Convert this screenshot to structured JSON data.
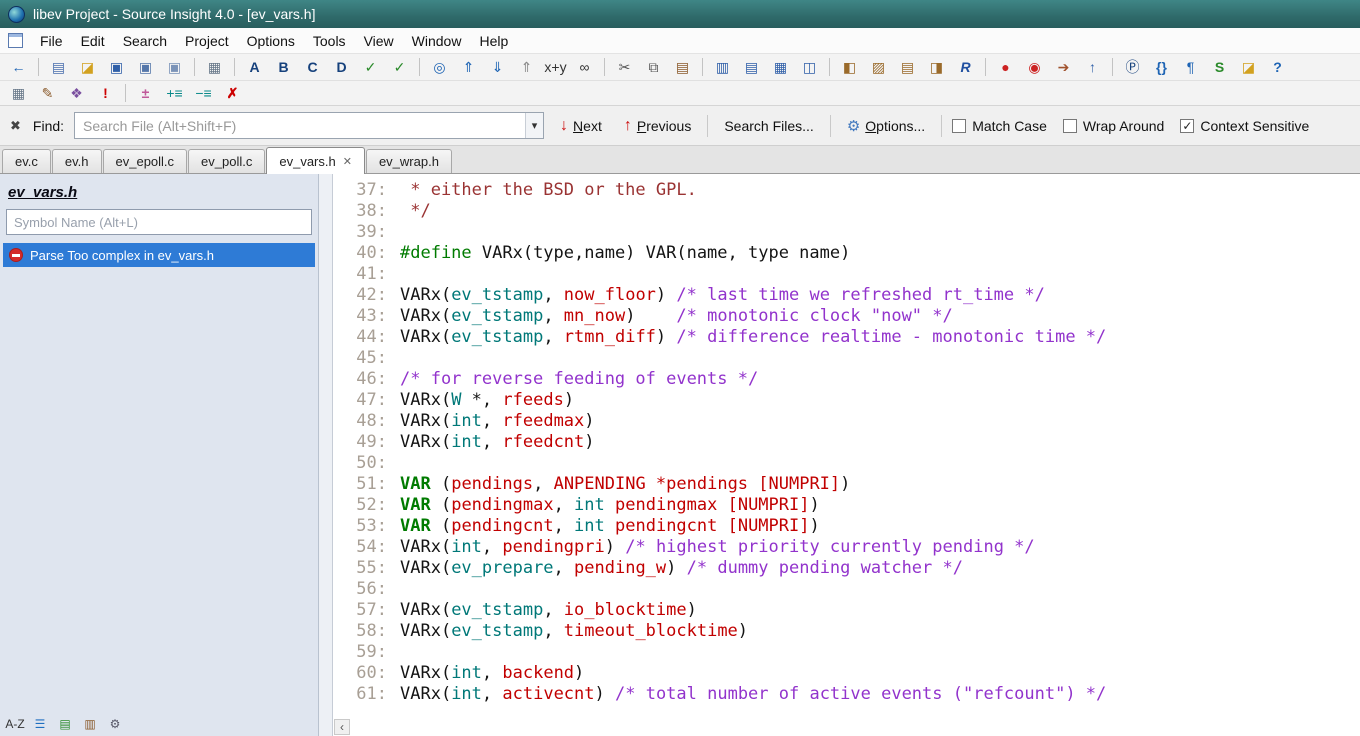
{
  "window": {
    "title": "libev Project - Source Insight 4.0 - [ev_vars.h]"
  },
  "menu": {
    "items": [
      "File",
      "Edit",
      "Search",
      "Project",
      "Options",
      "Tools",
      "View",
      "Window",
      "Help"
    ]
  },
  "colors": {
    "titlebar": "#2f6a6a",
    "selection_blue": "#2e7bd6",
    "syntax_keyword": "#007b00",
    "syntax_type": "#007878",
    "syntax_identifier": "#c10000",
    "syntax_comment_inline": "#9233cc",
    "syntax_comment_block": "#9a3333",
    "line_number": "#a89f95",
    "error_icon_red": "#d42a2a"
  },
  "toolbars": {
    "row1": [
      [
        {
          "n": "back-button",
          "g": "←",
          "c": "#1e64b4",
          "b": true
        }
      ],
      [
        {
          "n": "new-file-button",
          "g": "▤",
          "c": "#4a6fae"
        },
        {
          "n": "open-file-button",
          "g": "◪",
          "c": "#d2a11f"
        },
        {
          "n": "save-button",
          "g": "▣",
          "c": "#2f5fa8"
        },
        {
          "n": "save-as-button",
          "g": "▣",
          "c": "#5577aa"
        },
        {
          "n": "save-all-button",
          "g": "▣",
          "c": "#7a93b8"
        }
      ],
      [
        {
          "n": "print-button",
          "g": "▦",
          "c": "#667788"
        }
      ],
      [
        {
          "n": "custom-command-a-button",
          "g": "A",
          "c": "#16417c",
          "b": true
        },
        {
          "n": "custom-command-b-button",
          "g": "B",
          "c": "#16417c",
          "b": true
        },
        {
          "n": "custom-command-c-button",
          "g": "C",
          "c": "#16417c",
          "b": true
        },
        {
          "n": "custom-command-d-button",
          "g": "D",
          "c": "#16417c",
          "b": true
        },
        {
          "n": "checklist-1-button",
          "g": "✓",
          "c": "#2a8a2a"
        },
        {
          "n": "checklist-2-button",
          "g": "✓",
          "c": "#2a8a2a"
        }
      ],
      [
        {
          "n": "lookup-references-button",
          "g": "◎",
          "c": "#1e64b4"
        },
        {
          "n": "jump-to-caller-button",
          "g": "⇑",
          "c": "#1e64b4"
        },
        {
          "n": "jump-to-definition-button",
          "g": "⇓",
          "c": "#1e64b4"
        },
        {
          "n": "go-back-button",
          "g": "⇑",
          "c": "#888888"
        },
        {
          "n": "replace-button",
          "g": "x+y",
          "c": "#333333"
        },
        {
          "n": "browse-symbols-button",
          "g": "∞",
          "c": "#333333"
        }
      ],
      [
        {
          "n": "cut-button",
          "g": "✂",
          "c": "#555555"
        },
        {
          "n": "copy-button",
          "g": "⧉",
          "c": "#555555"
        },
        {
          "n": "paste-button",
          "g": "▤",
          "c": "#8a5a2b"
        }
      ],
      [
        {
          "n": "window-split-1-button",
          "g": "▥",
          "c": "#2f5fa8"
        },
        {
          "n": "window-split-2-button",
          "g": "▤",
          "c": "#2f5fa8"
        },
        {
          "n": "window-split-3-button",
          "g": "▦",
          "c": "#2f5fa8"
        },
        {
          "n": "window-split-4-button",
          "g": "◫",
          "c": "#2f5fa8"
        }
      ],
      [
        {
          "n": "project-window-button",
          "g": "◧",
          "c": "#9a6a2a"
        },
        {
          "n": "project-files-button",
          "g": "▨",
          "c": "#9a6a2a"
        },
        {
          "n": "symbol-window-button",
          "g": "▤",
          "c": "#9a6a2a"
        },
        {
          "n": "context-window-button",
          "g": "◨",
          "c": "#9a6a2a"
        },
        {
          "n": "relation-window-button",
          "g": "R",
          "c": "#1f4fa0",
          "b": true,
          "i": true
        }
      ],
      [
        {
          "n": "bookmark-toggle-button",
          "g": "●",
          "c": "#cc2222"
        },
        {
          "n": "bookmark-list-button",
          "g": "◉",
          "c": "#cc2222"
        },
        {
          "n": "jump-bookmark-button",
          "g": "➔",
          "c": "#a0522d"
        },
        {
          "n": "stack-up-button",
          "g": "↑",
          "c": "#2f5fa8",
          "b": true
        }
      ],
      [
        {
          "n": "parse-source-button",
          "g": "Ⓟ",
          "c": "#16417c"
        },
        {
          "n": "braces-button",
          "g": "{}",
          "c": "#1e64b4",
          "b": true
        },
        {
          "n": "reformat-button",
          "g": "¶",
          "c": "#1e64b4"
        },
        {
          "n": "script-button",
          "g": "S",
          "c": "#2a8a2a",
          "b": true
        },
        {
          "n": "reload-file-button",
          "g": "◪",
          "c": "#d2a11f"
        },
        {
          "n": "help-doc-button",
          "g": "?",
          "c": "#1e64b4",
          "b": true
        }
      ]
    ],
    "row2": [
      [
        {
          "n": "grid-view-button",
          "g": "▦",
          "c": "#667788"
        },
        {
          "n": "draft-edit-button",
          "g": "✎",
          "c": "#8a5a2b"
        },
        {
          "n": "stamp-button",
          "g": "❖",
          "c": "#7a4f9f"
        },
        {
          "n": "important-mark-button",
          "g": "!",
          "c": "#cc0000",
          "b": true
        }
      ],
      [
        {
          "n": "add-remove-button",
          "g": "±",
          "c": "#c05a9a",
          "b": true
        },
        {
          "n": "add-line-button",
          "g": "+≡",
          "c": "#0a8a8a"
        },
        {
          "n": "remove-line-button",
          "g": "−≡",
          "c": "#0a8a8a"
        },
        {
          "n": "delete-marked-button",
          "g": "✗",
          "c": "#cc0000",
          "b": true
        }
      ]
    ]
  },
  "find_bar": {
    "close_glyph": "✖",
    "label": "Find:",
    "placeholder": "Search File (Alt+Shift+F)",
    "dropdown_glyph": "▾",
    "next_icon": "↓",
    "next_label": "Next",
    "previous_icon": "↑",
    "previous_label": "Previous",
    "search_files_label": "Search Files...",
    "options_icon": "⚙",
    "options_label": "Options...",
    "check_glyph": "✓",
    "checkboxes": [
      {
        "label": "Match Case",
        "checked": false
      },
      {
        "label": "Wrap Around",
        "checked": false
      },
      {
        "label": "Context Sensitive",
        "checked": true
      }
    ]
  },
  "tabs": [
    {
      "label": "ev.c",
      "active": false
    },
    {
      "label": "ev.h",
      "active": false
    },
    {
      "label": "ev_epoll.c",
      "active": false
    },
    {
      "label": "ev_poll.c",
      "active": false
    },
    {
      "label": "ev_vars.h",
      "active": true
    },
    {
      "label": "ev_wrap.h",
      "active": false
    }
  ],
  "tab_close_glyph": "✕",
  "symbol_panel": {
    "title": "ev_vars.h",
    "search_placeholder": "Symbol Name (Alt+L)",
    "items": [
      {
        "label": "Parse Too complex in ev_vars.h",
        "selected": true,
        "icon": "no-entry"
      }
    ],
    "tools": [
      {
        "n": "sort-alphabetic-button",
        "g": "A-Z",
        "c": "#333333"
      },
      {
        "n": "symbol-list-button",
        "g": "☰",
        "c": "#1f6fc0"
      },
      {
        "n": "symbol-groups-button",
        "g": "▤",
        "c": "#2a8a2a"
      },
      {
        "n": "book-button",
        "g": "▥",
        "c": "#8a5a2b"
      },
      {
        "n": "panel-settings-button",
        "g": "⚙",
        "c": "#556"
      }
    ]
  },
  "editor": {
    "hscroll_left_glyph": "‹",
    "lines": [
      {
        "n": "37",
        "s": [
          [
            "cmb",
            " * either the BSD or the GPL."
          ]
        ]
      },
      {
        "n": "38",
        "s": [
          [
            "cmb",
            " */"
          ]
        ]
      },
      {
        "n": "39"
      },
      {
        "n": "40",
        "s": [
          [
            "kw",
            "#define"
          ],
          [
            "p",
            " VARx(type,name) VAR(name, type name)"
          ]
        ]
      },
      {
        "n": "41"
      },
      {
        "n": "42",
        "s": [
          [
            "p",
            "VARx("
          ],
          [
            "ty",
            "ev_tstamp"
          ],
          [
            "p",
            ", "
          ],
          [
            "id",
            "now_floor"
          ],
          [
            "p",
            ") "
          ],
          [
            "cm",
            "/* last time we refreshed rt_time */"
          ]
        ]
      },
      {
        "n": "43",
        "s": [
          [
            "p",
            "VARx("
          ],
          [
            "ty",
            "ev_tstamp"
          ],
          [
            "p",
            ", "
          ],
          [
            "id",
            "mn_now"
          ],
          [
            "p",
            ")    "
          ],
          [
            "cm",
            "/* monotonic clock \"now\" */"
          ]
        ]
      },
      {
        "n": "44",
        "s": [
          [
            "p",
            "VARx("
          ],
          [
            "ty",
            "ev_tstamp"
          ],
          [
            "p",
            ", "
          ],
          [
            "id",
            "rtmn_diff"
          ],
          [
            "p",
            ") "
          ],
          [
            "cm",
            "/* difference realtime - monotonic time */"
          ]
        ]
      },
      {
        "n": "45"
      },
      {
        "n": "46",
        "s": [
          [
            "cm",
            "/* for reverse feeding of events */"
          ]
        ]
      },
      {
        "n": "47",
        "s": [
          [
            "p",
            "VARx("
          ],
          [
            "ty",
            "W"
          ],
          [
            "p",
            " *, "
          ],
          [
            "id",
            "rfeeds"
          ],
          [
            "p",
            ")"
          ]
        ]
      },
      {
        "n": "48",
        "s": [
          [
            "p",
            "VARx("
          ],
          [
            "ty",
            "int"
          ],
          [
            "p",
            ", "
          ],
          [
            "id",
            "rfeedmax"
          ],
          [
            "p",
            ")"
          ]
        ]
      },
      {
        "n": "49",
        "s": [
          [
            "p",
            "VARx("
          ],
          [
            "ty",
            "int"
          ],
          [
            "p",
            ", "
          ],
          [
            "id",
            "rfeedcnt"
          ],
          [
            "p",
            ")"
          ]
        ]
      },
      {
        "n": "50"
      },
      {
        "n": "51",
        "s": [
          [
            "kwb",
            "VAR"
          ],
          [
            "p",
            " ("
          ],
          [
            "id",
            "pendings"
          ],
          [
            "p",
            ", "
          ],
          [
            "id",
            "ANPENDING *pendings [NUMPRI]"
          ],
          [
            "p",
            ")"
          ]
        ]
      },
      {
        "n": "52",
        "s": [
          [
            "kwb",
            "VAR"
          ],
          [
            "p",
            " ("
          ],
          [
            "id",
            "pendingmax"
          ],
          [
            "p",
            ", "
          ],
          [
            "ty",
            "int"
          ],
          [
            "p",
            " "
          ],
          [
            "id",
            "pendingmax [NUMPRI]"
          ],
          [
            "p",
            ")"
          ]
        ]
      },
      {
        "n": "53",
        "s": [
          [
            "kwb",
            "VAR"
          ],
          [
            "p",
            " ("
          ],
          [
            "id",
            "pendingcnt"
          ],
          [
            "p",
            ", "
          ],
          [
            "ty",
            "int"
          ],
          [
            "p",
            " "
          ],
          [
            "id",
            "pendingcnt [NUMPRI]"
          ],
          [
            "p",
            ")"
          ]
        ]
      },
      {
        "n": "54",
        "s": [
          [
            "p",
            "VARx("
          ],
          [
            "ty",
            "int"
          ],
          [
            "p",
            ", "
          ],
          [
            "id",
            "pendingpri"
          ],
          [
            "p",
            ") "
          ],
          [
            "cm",
            "/* highest priority currently pending */"
          ]
        ]
      },
      {
        "n": "55",
        "s": [
          [
            "p",
            "VARx("
          ],
          [
            "ty",
            "ev_prepare"
          ],
          [
            "p",
            ", "
          ],
          [
            "id",
            "pending_w"
          ],
          [
            "p",
            ") "
          ],
          [
            "cm",
            "/* dummy pending watcher */"
          ]
        ]
      },
      {
        "n": "56"
      },
      {
        "n": "57",
        "s": [
          [
            "p",
            "VARx("
          ],
          [
            "ty",
            "ev_tstamp"
          ],
          [
            "p",
            ", "
          ],
          [
            "id",
            "io_blocktime"
          ],
          [
            "p",
            ")"
          ]
        ]
      },
      {
        "n": "58",
        "s": [
          [
            "p",
            "VARx("
          ],
          [
            "ty",
            "ev_tstamp"
          ],
          [
            "p",
            ", "
          ],
          [
            "id",
            "timeout_blocktime"
          ],
          [
            "p",
            ")"
          ]
        ]
      },
      {
        "n": "59"
      },
      {
        "n": "60",
        "s": [
          [
            "p",
            "VARx("
          ],
          [
            "ty",
            "int"
          ],
          [
            "p",
            ", "
          ],
          [
            "id",
            "backend"
          ],
          [
            "p",
            ")"
          ]
        ]
      },
      {
        "n": "61",
        "s": [
          [
            "p",
            "VARx("
          ],
          [
            "ty",
            "int"
          ],
          [
            "p",
            ", "
          ],
          [
            "id",
            "activecnt"
          ],
          [
            "p",
            ") "
          ],
          [
            "cm",
            "/* total number of active events (\"refcount\") */"
          ]
        ]
      }
    ]
  }
}
